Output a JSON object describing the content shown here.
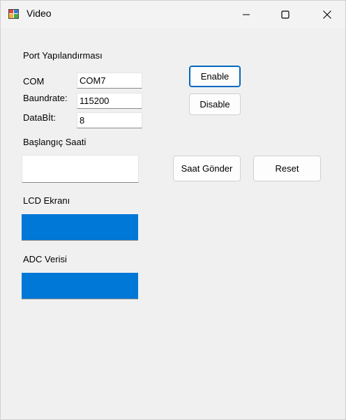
{
  "window": {
    "title": "Video",
    "minimize_icon": "minimize-icon",
    "maximize_icon": "maximize-icon",
    "close_icon": "close-icon"
  },
  "port_config": {
    "heading": "Port Yapılandırması",
    "com_label": "COM",
    "com_value": "COM7",
    "baud_label": "Baundrate:",
    "baud_value": "115200",
    "databit_label": "DataBİt:",
    "databit_value": "8",
    "enable_label": "Enable",
    "disable_label": "Disable"
  },
  "start_time": {
    "heading": "Başlangıç Saati",
    "value": "",
    "send_label": "Saat Gönder",
    "reset_label": "Reset"
  },
  "lcd": {
    "heading": "LCD Ekranı",
    "color": "#0078d7"
  },
  "adc": {
    "heading": "ADC Verisi",
    "color": "#0078d7"
  },
  "colors": {
    "accent": "#0067c0",
    "window_bg": "#f0f0f0"
  }
}
